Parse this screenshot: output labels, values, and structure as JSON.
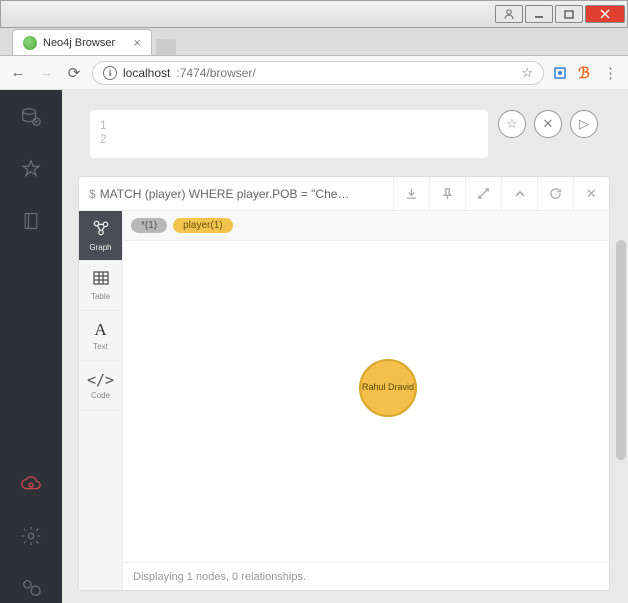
{
  "window": {
    "tab_title": "Neo4j Browser"
  },
  "address": {
    "host": "localhost",
    "port_path": ":7474/browser/"
  },
  "editor": {
    "line1": "1",
    "line2": "2"
  },
  "result": {
    "query_prefix": "$",
    "query": "MATCH (player)  WHERE player.POB = \"Che…",
    "views": {
      "graph": "Graph",
      "table": "Table",
      "text": "Text",
      "code": "Code"
    },
    "chips": {
      "star": "*(1)",
      "player": "player(1)"
    },
    "node_label": "Rahul Dravid",
    "status": "Displaying 1 nodes, 0 relationships."
  }
}
